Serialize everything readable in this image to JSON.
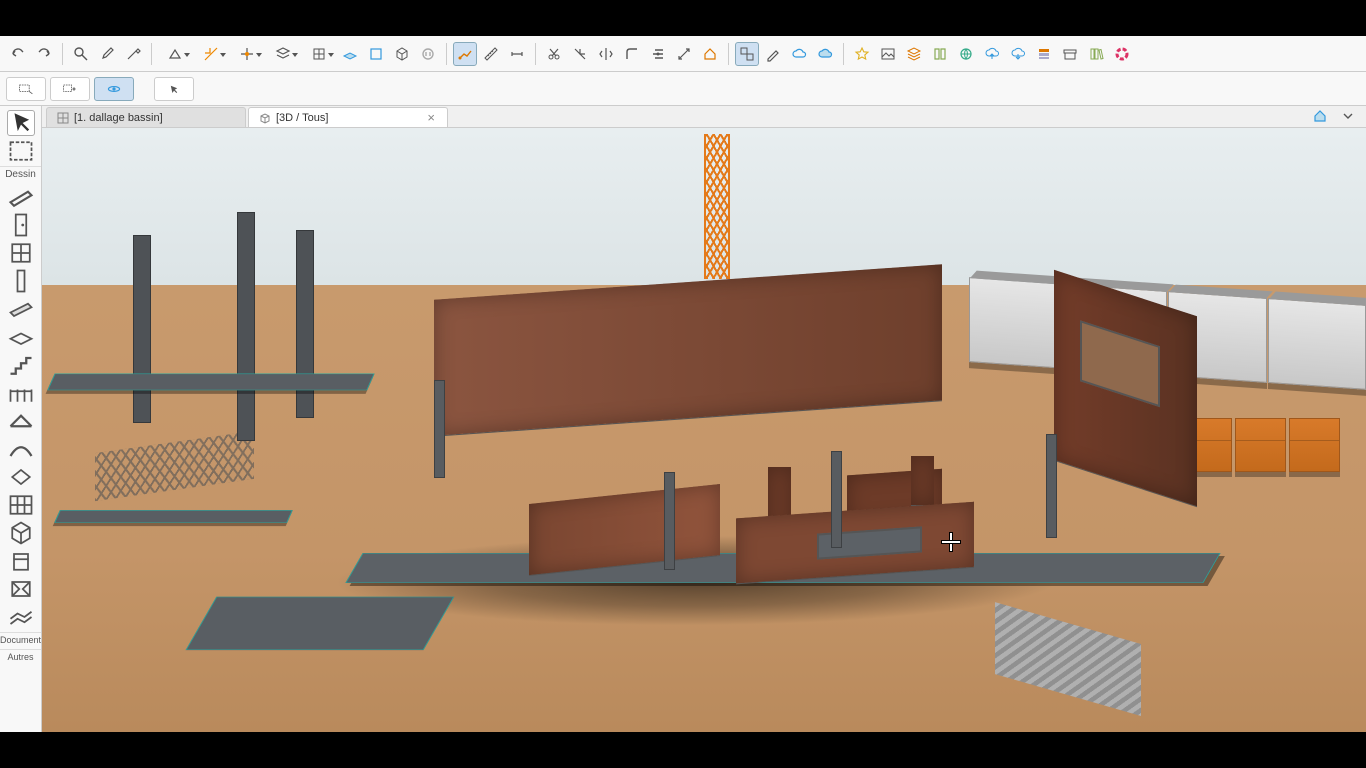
{
  "tabs": [
    {
      "label": "[1. dallage bassin]",
      "icon": "plan-icon",
      "active": false,
      "closable": false
    },
    {
      "label": "[3D / Tous]",
      "icon": "cube-icon",
      "active": true,
      "closable": true
    }
  ],
  "left_palette": {
    "section1": "Dessin",
    "section2": "Documents",
    "section3": "Autres",
    "tools": [
      "arrow-tool",
      "marquee-tool",
      "wall-tool",
      "door-tool",
      "window-tool",
      "column-tool",
      "beam-tool",
      "slab-tool",
      "stair-tool",
      "railing-tool",
      "roof-tool",
      "shell-tool",
      "skylight-tool",
      "curtainwall-tool",
      "morph-tool",
      "object-tool",
      "zone-tool",
      "mesh-tool"
    ]
  },
  "toolbar1_groups": [
    {
      "icons": [
        "undo-icon",
        "redo-icon"
      ]
    },
    {
      "icons": [
        "zoom-icon",
        "eyedrop-icon",
        "inject-icon"
      ]
    },
    {
      "icons": [
        "triangle-icon",
        "guideline-icon",
        "snap-icon",
        "layer-icon",
        "grid-icon",
        "workplane-icon",
        "plane-icon",
        "box3d-icon",
        "suspend-icon"
      ]
    },
    {
      "icons": [
        "trace-icon",
        "measure-icon",
        "dimension-icon"
      ]
    },
    {
      "icons": [
        "cut-icon",
        "trim-icon",
        "split-icon",
        "fillet-icon",
        "adjust-icon",
        "resize-icon",
        "home-icon"
      ]
    },
    {
      "icons": [
        "group-icon",
        "edit-icon",
        "cloud1-icon",
        "cloud2-icon"
      ]
    },
    {
      "icons": [
        "favorite-icon",
        "image-icon",
        "layers-icon",
        "library-icon",
        "earth-icon",
        "cloudup-icon",
        "clouddown-icon",
        "stack-icon",
        "archive-icon",
        "books-icon",
        "color-icon"
      ]
    }
  ],
  "toolbar2_icons": [
    "selection-rect-icon",
    "marquee-add-icon",
    "orbit-icon",
    "pointer-icon"
  ],
  "tab_right_icon": "house-3d-icon",
  "colors": {
    "wall": "#8b4a33",
    "steel": "#585c60",
    "crane": "#e47a1a",
    "ground": "#c89a6d",
    "sky": "#e0e8ea",
    "outline": "#2aa39a"
  }
}
